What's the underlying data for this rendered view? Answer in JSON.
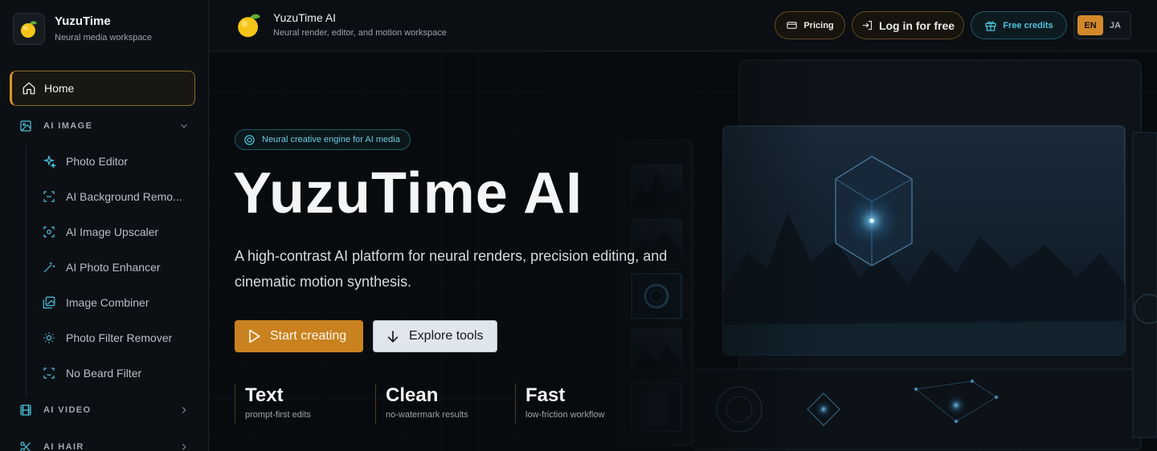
{
  "sidebar": {
    "brand_title": "YuzuTime",
    "brand_subtitle": "Neural media workspace",
    "home_label": "Home",
    "groups": [
      {
        "label": "AI IMAGE",
        "expanded": true
      },
      {
        "label": "AI VIDEO",
        "expanded": false
      },
      {
        "label": "AI HAIR",
        "expanded": false
      }
    ],
    "image_items": [
      {
        "label": "Photo Editor",
        "icon": "sparkles-icon"
      },
      {
        "label": "AI Background Remo...",
        "icon": "scan-icon"
      },
      {
        "label": "AI Image Upscaler",
        "icon": "upscale-icon"
      },
      {
        "label": "AI Photo Enhancer",
        "icon": "wand-icon"
      },
      {
        "label": "Image Combiner",
        "icon": "images-icon"
      },
      {
        "label": "Photo Filter Remover",
        "icon": "sun-filter-icon"
      },
      {
        "label": "No Beard Filter",
        "icon": "face-scan-icon"
      }
    ]
  },
  "topbar": {
    "title": "YuzuTime AI",
    "subtitle": "Neural render, editor, and motion workspace",
    "pricing_label": "Pricing",
    "login_label": "Log in for free",
    "credits_label": "Free credits",
    "lang_active": "EN",
    "lang_other": "JA"
  },
  "hero": {
    "badge": "Neural creative engine for AI media",
    "title": "YuzuTime AI",
    "description": "A high-contrast AI platform for neural renders, precision editing, and cinematic motion synthesis.",
    "primary_cta": "Start creating",
    "secondary_cta": "Explore tools",
    "stats": [
      {
        "value": "Text",
        "caption": "prompt-first edits"
      },
      {
        "value": "Clean",
        "caption": "no-watermark results"
      },
      {
        "value": "Fast",
        "caption": "low-friction workflow"
      }
    ]
  },
  "colors": {
    "accent": "#c9821f",
    "cyan": "#4fc3db",
    "background": "#0a0d10"
  }
}
